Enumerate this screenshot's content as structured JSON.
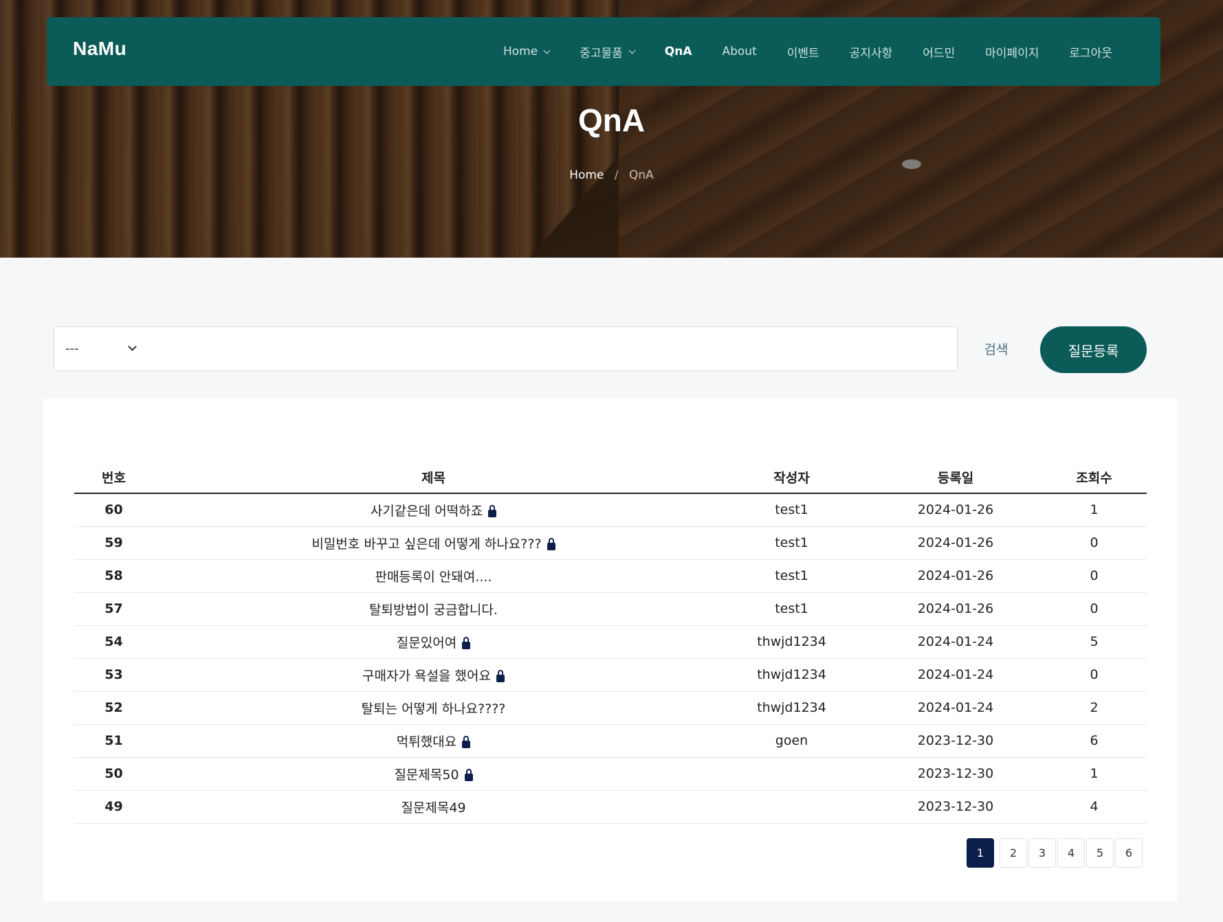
{
  "brand": "NaMu",
  "nav": [
    {
      "label": "Home",
      "dropdown": true,
      "active": false
    },
    {
      "label": "중고물품",
      "dropdown": true,
      "active": false
    },
    {
      "label": "QnA",
      "dropdown": false,
      "active": true
    },
    {
      "label": "About",
      "dropdown": false,
      "active": false
    },
    {
      "label": "이벤트",
      "dropdown": false,
      "active": false
    },
    {
      "label": "공지사항",
      "dropdown": false,
      "active": false
    },
    {
      "label": "어드민",
      "dropdown": false,
      "active": false
    },
    {
      "label": "마이페이지",
      "dropdown": false,
      "active": false
    },
    {
      "label": "로그아웃",
      "dropdown": false,
      "active": false
    }
  ],
  "page_title": "QnA",
  "breadcrumb": {
    "home": "Home",
    "separator": "/",
    "current": "QnA"
  },
  "search": {
    "select_value": "---",
    "input_value": "",
    "button": "검색"
  },
  "register_button": "질문등록",
  "table": {
    "columns": [
      "번호",
      "제목",
      "작성자",
      "등록일",
      "조회수"
    ],
    "rows": [
      {
        "num": "60",
        "title": "사기같은데 어떡하죠",
        "locked": true,
        "author": "test1",
        "date": "2024-01-26",
        "views": "1"
      },
      {
        "num": "59",
        "title": "비밀번호 바꾸고 싶은데 어떻게 하나요???",
        "locked": true,
        "author": "test1",
        "date": "2024-01-26",
        "views": "0"
      },
      {
        "num": "58",
        "title": "판매등록이 안돼여....",
        "locked": false,
        "author": "test1",
        "date": "2024-01-26",
        "views": "0"
      },
      {
        "num": "57",
        "title": "탈퇴방법이 궁금합니다.",
        "locked": false,
        "author": "test1",
        "date": "2024-01-26",
        "views": "0"
      },
      {
        "num": "54",
        "title": "질문있어여",
        "locked": true,
        "author": "thwjd1234",
        "date": "2024-01-24",
        "views": "5"
      },
      {
        "num": "53",
        "title": "구매자가 욕설을 했어요",
        "locked": true,
        "author": "thwjd1234",
        "date": "2024-01-24",
        "views": "0"
      },
      {
        "num": "52",
        "title": "탈퇴는 어떻게 하나요????",
        "locked": false,
        "author": "thwjd1234",
        "date": "2024-01-24",
        "views": "2"
      },
      {
        "num": "51",
        "title": "먹튀했대요",
        "locked": true,
        "author": "goen",
        "date": "2023-12-30",
        "views": "6"
      },
      {
        "num": "50",
        "title": "질문제목50",
        "locked": true,
        "author": "",
        "date": "2023-12-30",
        "views": "1"
      },
      {
        "num": "49",
        "title": "질문제목49",
        "locked": false,
        "author": "",
        "date": "2023-12-30",
        "views": "4"
      }
    ]
  },
  "pagination": {
    "pages": [
      "1",
      "2",
      "3",
      "4",
      "5",
      "6"
    ],
    "current": "1"
  },
  "colors": {
    "primary": "#0b5b58",
    "pager_active": "#0c1f4a",
    "lock_icon": "#0c1f4a"
  }
}
